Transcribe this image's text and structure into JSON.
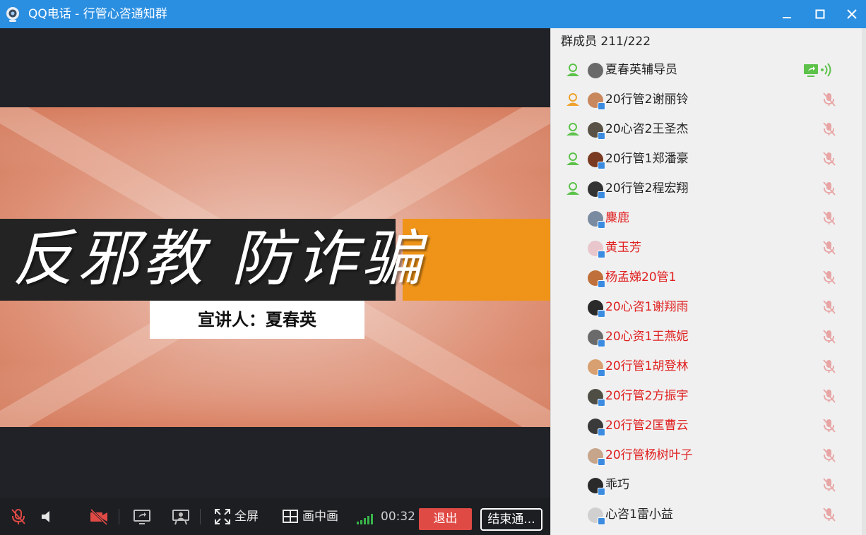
{
  "window": {
    "title": "QQ电话 - 行管心咨通知群",
    "accent": "#2b8fe1"
  },
  "slide": {
    "banner_title": "反邪教  防诈骗",
    "speaker": "宣讲人：夏春英",
    "colors": {
      "dark": "#232323",
      "orange": "#ef9419"
    }
  },
  "toolbar": {
    "mic_icon": "mic-muted-icon",
    "speaker_icon": "speaker-icon",
    "camera_icon": "camera-off-icon",
    "share_icon": "screen-share-icon",
    "present_icon": "presentation-icon",
    "fullscreen_label": "全屏",
    "pip_label": "画中画",
    "timer": "00:32",
    "exit_label": "退出",
    "end_label": "结束通..."
  },
  "members_panel": {
    "header": "群成员 211/222",
    "members": [
      {
        "name": "夏春英辅导员",
        "color": "#222222",
        "role": "green",
        "avatar": "#6a6a6a",
        "status": "sharing"
      },
      {
        "name": "20行管2谢丽铃",
        "color": "#222222",
        "role": "orange",
        "avatar": "#c9875e",
        "status": "muted"
      },
      {
        "name": "20心咨2王圣杰",
        "color": "#222222",
        "role": "green",
        "avatar": "#5a5246",
        "status": "muted"
      },
      {
        "name": "20行管1郑潘豪",
        "color": "#222222",
        "role": "green",
        "avatar": "#7a3a22",
        "status": "muted"
      },
      {
        "name": "20行管2程宏翔",
        "color": "#222222",
        "role": "green",
        "avatar": "#333333",
        "status": "muted"
      },
      {
        "name": "麋鹿",
        "color": "#e02020",
        "role": "",
        "avatar": "#7a8aa0",
        "status": "muted"
      },
      {
        "name": "黄玉芳",
        "color": "#e02020",
        "role": "",
        "avatar": "#e8c6cc",
        "status": "muted"
      },
      {
        "name": "杨孟娣20管1",
        "color": "#e02020",
        "role": "",
        "avatar": "#c0703a",
        "status": "muted"
      },
      {
        "name": "20心咨1谢翔雨",
        "color": "#e02020",
        "role": "",
        "avatar": "#2a2a2a",
        "status": "muted"
      },
      {
        "name": "20心资1王燕妮",
        "color": "#e02020",
        "role": "",
        "avatar": "#6a6a6a",
        "status": "muted"
      },
      {
        "name": "20行管1胡登林",
        "color": "#e02020",
        "role": "",
        "avatar": "#d8a070",
        "status": "muted"
      },
      {
        "name": "20行管2方振宇",
        "color": "#e02020",
        "role": "",
        "avatar": "#4e4e44",
        "status": "muted"
      },
      {
        "name": "20行管2匡曹云",
        "color": "#e02020",
        "role": "",
        "avatar": "#3a3a3a",
        "status": "muted"
      },
      {
        "name": "20行管杨树叶子",
        "color": "#e02020",
        "role": "",
        "avatar": "#c7a58a",
        "status": "muted"
      },
      {
        "name": "乖巧",
        "color": "#222222",
        "role": "",
        "avatar": "#2a2a2a",
        "status": "muted"
      },
      {
        "name": "心咨1雷小益",
        "color": "#222222",
        "role": "",
        "avatar": "#d0d0d0",
        "status": "muted"
      }
    ]
  }
}
